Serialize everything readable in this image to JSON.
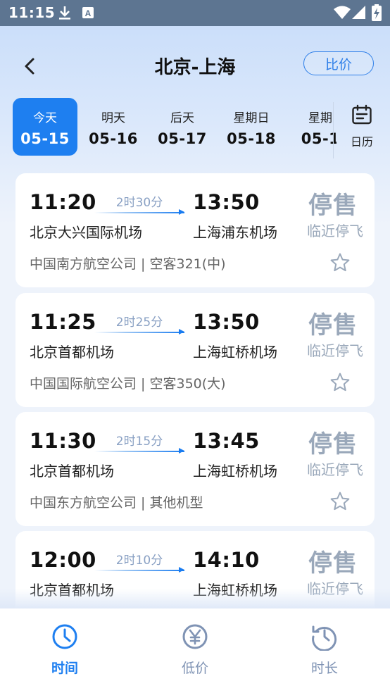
{
  "status_bar": {
    "time": "11:15",
    "icons": [
      "download-icon",
      "text-recognition-icon",
      "wifi-icon",
      "cellular-signal-icon",
      "battery-charging-icon"
    ]
  },
  "header": {
    "back_icon": "chevron-left-icon",
    "title": "北京-上海",
    "compare_label": "比价"
  },
  "dates": [
    {
      "day": "今天",
      "date": "05-15",
      "selected": true
    },
    {
      "day": "明天",
      "date": "05-16",
      "selected": false
    },
    {
      "day": "后天",
      "date": "05-17",
      "selected": false
    },
    {
      "day": "星期日",
      "date": "05-18",
      "selected": false
    },
    {
      "day": "星期",
      "date": "05-1",
      "selected": false
    }
  ],
  "calendar": {
    "icon": "calendar-icon",
    "label": "日历"
  },
  "flights": [
    {
      "dep_time": "11:20",
      "duration": "2时30分",
      "arr_time": "13:50",
      "dep_airport": "北京大兴国际机场",
      "arr_airport": "上海浦东机场",
      "airline": "中国南方航空公司 | 空客321(中)",
      "status": "停售",
      "note": "临近停飞"
    },
    {
      "dep_time": "11:25",
      "duration": "2时25分",
      "arr_time": "13:50",
      "dep_airport": "北京首都机场",
      "arr_airport": "上海虹桥机场",
      "airline": "中国国际航空公司 | 空客350(大)",
      "status": "停售",
      "note": "临近停飞"
    },
    {
      "dep_time": "11:30",
      "duration": "2时15分",
      "arr_time": "13:45",
      "dep_airport": "北京首都机场",
      "arr_airport": "上海虹桥机场",
      "airline": "中国东方航空公司 | 其他机型",
      "status": "停售",
      "note": "临近停飞"
    },
    {
      "dep_time": "12:00",
      "duration": "2时10分",
      "arr_time": "14:10",
      "dep_airport": "北京首都机场",
      "arr_airport": "上海虹桥机场",
      "airline": "",
      "status": "停售",
      "note": "临近停飞"
    }
  ],
  "tabs": [
    {
      "label": "时间",
      "icon": "clock-icon",
      "active": true
    },
    {
      "label": "低价",
      "icon": "yuan-icon",
      "active": false
    },
    {
      "label": "时长",
      "icon": "history-icon",
      "active": false
    }
  ],
  "colors": {
    "accent": "#1e7ff0",
    "status_bar": "#5d7591",
    "muted": "#9aa8ba"
  }
}
